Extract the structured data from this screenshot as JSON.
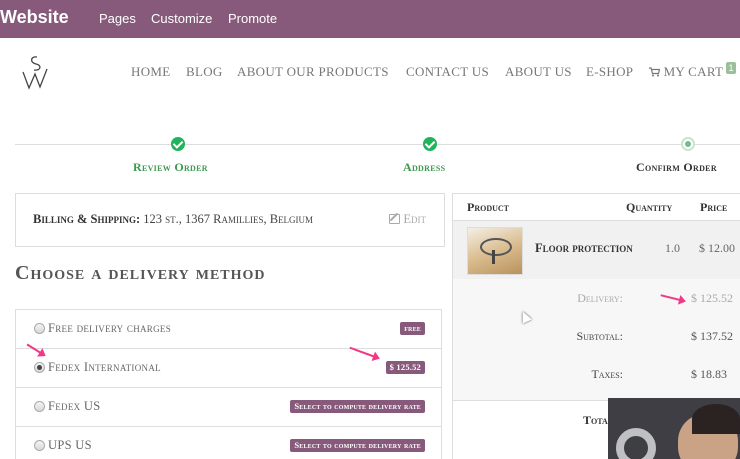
{
  "topbar": {
    "brand": "Website",
    "menu": [
      "Pages",
      "Customize",
      "Promote"
    ]
  },
  "header": {
    "nav": [
      "HOME",
      "BLOG",
      "ABOUT OUR PRODUCTS",
      "CONTACT US",
      "ABOUT US",
      "E-SHOP"
    ],
    "cart_label": "MY CART",
    "cart_count": "1"
  },
  "steps": [
    {
      "label": "Review Order",
      "state": "done"
    },
    {
      "label": "Address",
      "state": "done"
    },
    {
      "label": "Confirm Order",
      "state": "current"
    }
  ],
  "billing": {
    "label": "Billing & Shipping:",
    "address": "123 st., 1367 Ramillies, Belgium",
    "edit": "Edit"
  },
  "delivery": {
    "title": "Choose a delivery method",
    "methods": [
      {
        "name": "Free delivery charges",
        "badge": "free",
        "selected": false
      },
      {
        "name": "Fedex International",
        "badge": "$ 125.52",
        "selected": true
      },
      {
        "name": "Fedex US",
        "badge": "Select to compute delivery rate",
        "selected": false
      },
      {
        "name": "UPS US",
        "badge": "Select to compute delivery rate",
        "selected": false
      }
    ]
  },
  "cart": {
    "headers": {
      "product": "Product",
      "quantity": "Quantity",
      "price": "Price"
    },
    "product": {
      "name": "Floor protection",
      "qty": "1.0",
      "price": "$ 12.00"
    },
    "totals": [
      {
        "label": "Delivery:",
        "value": "$ 125.52"
      },
      {
        "label": "Subtotal:",
        "value": "$ 137.52"
      },
      {
        "label": "Taxes:",
        "value": "$ 18.83"
      }
    ],
    "total_label": "Tota"
  },
  "colors": {
    "brand": "#875a7b",
    "success": "#21b25c",
    "annotation": "#ef3b86"
  }
}
